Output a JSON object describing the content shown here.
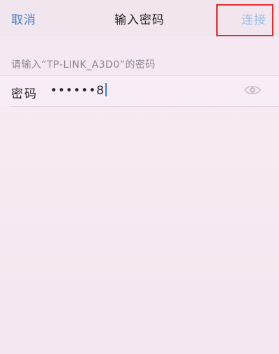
{
  "navbar": {
    "cancel_label": "取消",
    "title": "输入密码",
    "connect_label": "连接"
  },
  "section": {
    "header": "请输入“TP-LINK_A3D0”的密码"
  },
  "password_field": {
    "label": "密码",
    "value": "••••••8",
    "toggle_icon": "eye-icon"
  },
  "colors": {
    "accent": "#3f79d8",
    "connect_disabled": "#9ec0ef",
    "highlight": "#e52b2b",
    "background": "#f4e7f1"
  }
}
